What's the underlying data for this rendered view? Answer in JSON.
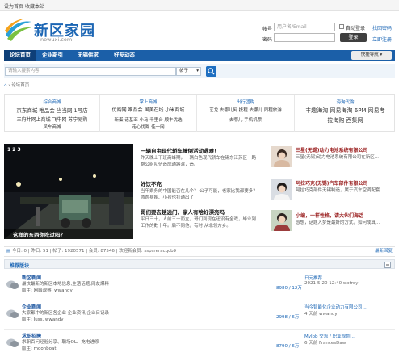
{
  "topbar": {
    "home": "设为首页",
    "fav": "收藏本站"
  },
  "header": {
    "logo_text": "新区家园",
    "logo_sub": "newuxi.com",
    "account_label": "帐号",
    "password_label": "密码",
    "account_placeholder": "用户名/Email",
    "remember": "自动登录",
    "forgot": "找回密码",
    "login": "登录",
    "register": "立即注册"
  },
  "nav": {
    "items": [
      "论坛首页",
      "企业新引",
      "无锡供求",
      "好友动态"
    ],
    "quick": "快捷导航"
  },
  "search": {
    "placeholder": "请输入搜索内容",
    "type": "帖子"
  },
  "breadcrumb": "论坛首页",
  "ads": [
    {
      "title": "综合商城",
      "rows": [
        "京东商城 唯品会 当当网 1号店",
        "王府井网上商城 飞牛网 苏宁易购",
        "风车商城"
      ]
    },
    {
      "title": "掌上商城",
      "rows": [
        "优购网 唯品会 国美在线 小米商城",
        "新蛋 诺基亚 小马 千里台 顺丰优选",
        "走心优购 佳一网"
      ]
    },
    {
      "title": "出行团购",
      "rows": [
        "艺龙 去哪儿网 携程 去哪儿 同程旅游",
        "去哪儿 手机机票"
      ]
    },
    {
      "title": "海淘代购",
      "rows": [
        "丰趣海淘 网易海淘 6PM 网易考",
        "拉海购 西集网"
      ]
    }
  ],
  "hero": {
    "slide_nums": "1 2 3",
    "slide_caption": "这样的东西你吃过吗？",
    "news": [
      {
        "title": "一辆自由现代轿车撞倒活动遇难！",
        "desc": "昨天晚上下班高峰期，一辆白色现代轿车在锡东江苏区一路群公组队伍造成通路混，造。"
      },
      {
        "title": "好饮不充",
        "desc": "当年乘务的中国能否在几个？ 公子可能，老家比我都要多？ 圆圆身姨、小孩也打通出了"
      },
      {
        "title": "哥们要去趟远门，家人有啥好漂亮吗",
        "desc": "平日三十，人前三十而立，哥们到现在还没有全戏，毕业到工作的数十年。后不同他，有时 从北领方乡。"
      }
    ],
    "right_news": [
      {
        "title": "三星(无锡)动力电池系统有限公司",
        "desc": "三星(无锡)动力电池系统有限公司在新区..."
      },
      {
        "title": "阿拉巧克(无锡)汽车部件有限公司",
        "desc": "阿拉巧克部件无锡制造，属于汽车空调配套..."
      },
      {
        "title": "小编，一样性格，请大伙们海话",
        "desc": "感想，话题入梦是最好的方式，如何成真..."
      }
    ]
  },
  "stats": {
    "text": "今日: 0 | 昨日: 51 | 帖子: 1920571 | 会员: 87546 | 欢迎新会员: sspsreracqcb9",
    "latest": "最新回复"
  },
  "forum": {
    "header": "推荐版块",
    "rows": [
      {
        "name": "新区新闻",
        "desc": "最快最新的新区本地信息,生活话题,网友爆料",
        "mod": "版主: 网络观察, wwandy",
        "count": "8980 / 12万",
        "last1": "日元推荐",
        "last2": "2021-5-20 12:40 wxtroy"
      },
      {
        "name": "企业新闻",
        "desc": "大家都中的新区各企业 企业资讯 企业日记录",
        "mod": "版主: Juss, wwandy",
        "count": "2998 / 6万",
        "last1": "当今智能化企业动力有限公司...",
        "last2": "4 天前 wwandy"
      },
      {
        "name": "求职招聘",
        "desc": "求职百问经验分享、职场OL、充电进修",
        "mod": "版主: moonboat",
        "count": "8790 / 6万",
        "last1": "MyJob 交流 / 职业规划...",
        "last2": "6 天前 FrancesDaw"
      }
    ]
  }
}
